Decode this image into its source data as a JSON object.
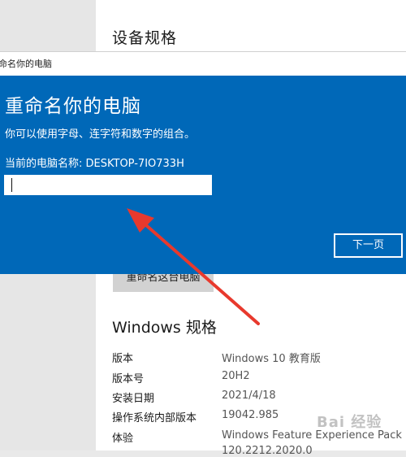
{
  "settings": {
    "device_spec_title": "设备规格",
    "rename_button": "重命名这台电脑",
    "windows_spec_title": "Windows 规格",
    "specs": [
      {
        "label": "版本",
        "value": "Windows 10 教育版"
      },
      {
        "label": "版本号",
        "value": "20H2"
      },
      {
        "label": "安装日期",
        "value": "2021/4/18"
      },
      {
        "label": "操作系统内部版本",
        "value": "19042.985"
      },
      {
        "label": "体验",
        "value": "Windows Feature Experience Pack"
      },
      {
        "label": "",
        "value": "120.2212.2020.0"
      }
    ]
  },
  "dialog": {
    "titlebar_text": "命名你的电脑",
    "heading": "重命名你的电脑",
    "description": "你可以使用字母、连字符和数字的组合。",
    "current_name": "当前的电脑名称: DESKTOP-7IO733H",
    "input_value": "",
    "next_button": "下一页"
  },
  "watermark": "Bai 经验",
  "colors": {
    "dialog_blue": "#0068b8",
    "arrow_red": "#e8392d"
  }
}
